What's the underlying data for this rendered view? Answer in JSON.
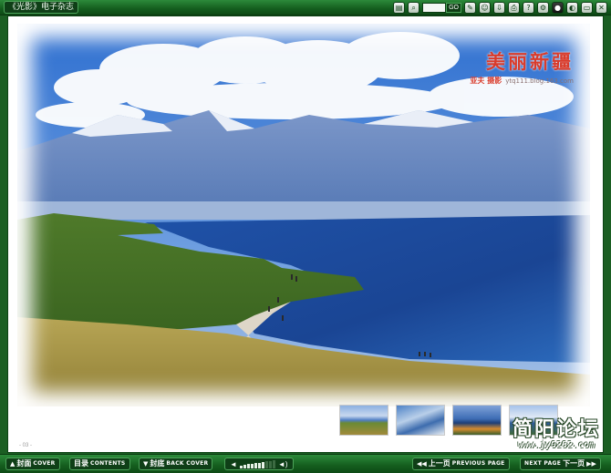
{
  "window": {
    "title": "《光影》电子杂志"
  },
  "toolbar": {
    "goto_label": "GO",
    "icons": [
      "notes-icon",
      "search-icon",
      "goto-page",
      "comment-icon",
      "user-icon",
      "download-icon",
      "print-icon",
      "help-icon",
      "settings-icon",
      "record-icon",
      "theme-icon",
      "minimize-icon",
      "close-icon"
    ]
  },
  "page": {
    "caption_title": "美丽新疆",
    "caption_credit": "亚夫 摄影",
    "caption_url": "ytq111.blog.163.com",
    "page_number": "- 03 -"
  },
  "thumbnails": [
    {
      "name": "thumb-1"
    },
    {
      "name": "thumb-2"
    },
    {
      "name": "thumb-3"
    },
    {
      "name": "thumb-4"
    }
  ],
  "watermark": {
    "title": "简阳论坛",
    "url": "www.jy0282.com"
  },
  "nav": {
    "cover_zh": "封面",
    "cover_en": "COVER",
    "contents_zh": "目录",
    "contents_en": "CONTENTS",
    "back_zh": "封底",
    "back_en": "BACK COVER",
    "prev_zh": "上一页",
    "prev_en": "PREVIOUS PAGE",
    "next_en": "NEXT PAGE",
    "next_zh": "下一页"
  },
  "volume": {
    "level": 0.7
  },
  "colors": {
    "frame_green": "#145d1e",
    "caption_red": "#d93b2b"
  }
}
